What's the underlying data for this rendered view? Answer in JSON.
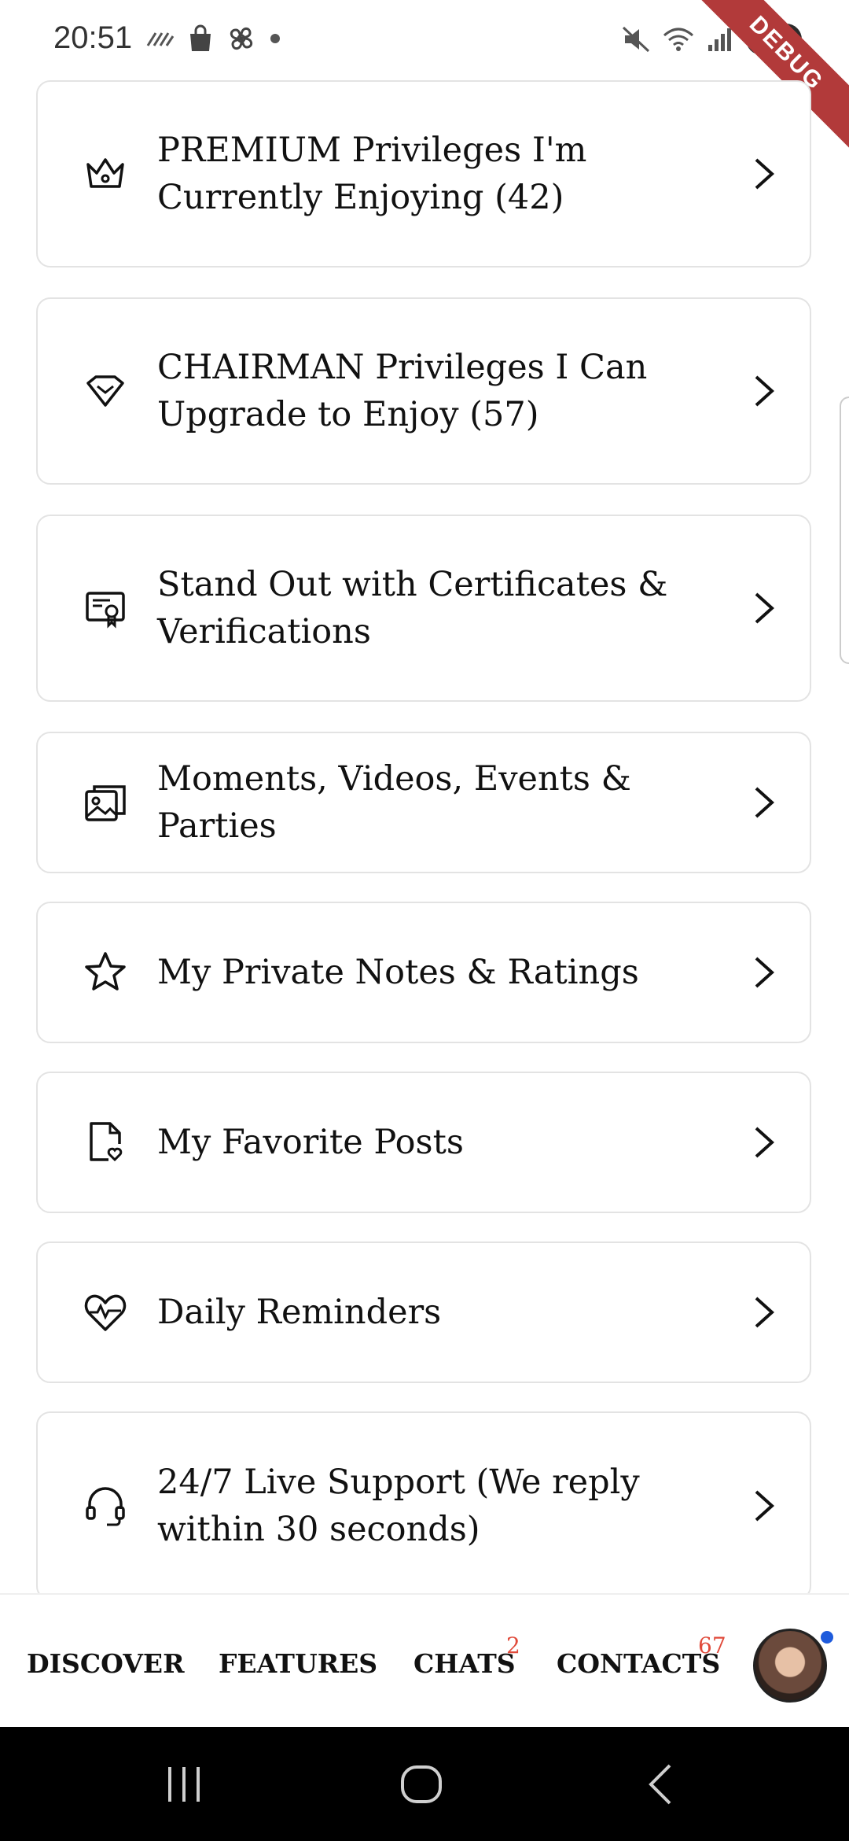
{
  "status_bar": {
    "time": "20:51",
    "battery": "100",
    "debug_label": "DEBUG"
  },
  "menu": {
    "items": [
      {
        "label": "PREMIUM Privileges I'm Currently Enjoying (42)",
        "icon": "crown-icon"
      },
      {
        "label": "CHAIRMAN Privileges I Can Upgrade to Enjoy (57)",
        "icon": "diamond-icon"
      },
      {
        "label": "Stand Out with Certificates & Verifications",
        "icon": "certificate-icon"
      },
      {
        "label": "Moments, Videos, Events & Parties",
        "icon": "gallery-icon"
      },
      {
        "label": "My Private Notes & Ratings",
        "icon": "star-icon"
      },
      {
        "label": "My Favorite Posts",
        "icon": "favorite-document-icon"
      },
      {
        "label": "Daily Reminders",
        "icon": "heart-pulse-icon"
      },
      {
        "label": "24/7 Live Support (We reply within 30 seconds)",
        "icon": "headset-icon"
      }
    ]
  },
  "bottom_nav": {
    "discover": "DISCOVER",
    "features": "FEATURES",
    "chats": "CHATS",
    "chats_badge": "2",
    "contacts": "CONTACTS",
    "contacts_badge": "67"
  },
  "colors": {
    "badge": "#e04a3a",
    "card_border": "#e3e3e3",
    "online_dot": "#1e5bdc",
    "debug_ribbon": "#b23a3a"
  }
}
